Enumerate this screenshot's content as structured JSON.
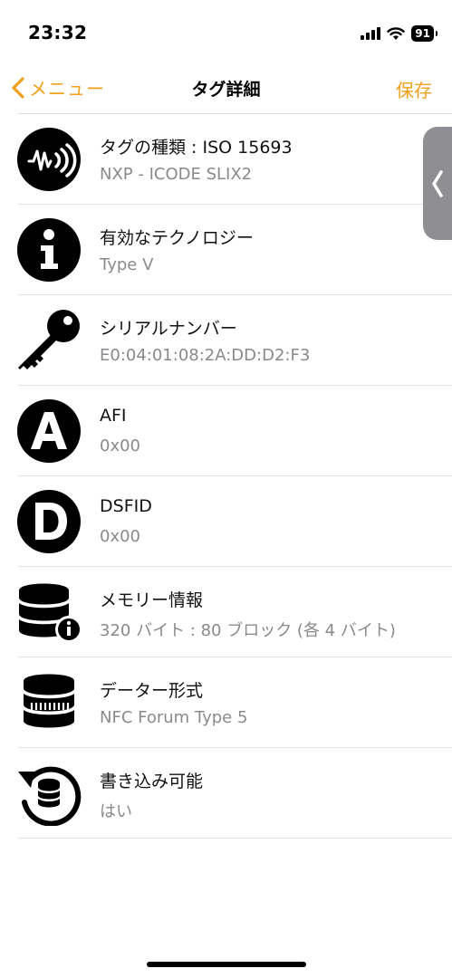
{
  "status_bar": {
    "time": "23:32",
    "battery": "91"
  },
  "nav": {
    "back_label": "メニュー",
    "title": "タグ詳細",
    "save_label": "保存"
  },
  "rows": [
    {
      "icon": "nfc-wave-icon",
      "title": "タグの種類 : ISO 15693",
      "value": "NXP - ICODE SLIX2"
    },
    {
      "icon": "info-icon",
      "title": "有効なテクノロジー",
      "value": "Type V"
    },
    {
      "icon": "key-icon",
      "title": "シリアルナンバー",
      "value": "E0:04:01:08:2A:DD:D2:F3"
    },
    {
      "icon": "letter-a-icon",
      "title": "AFI",
      "value": "0x00"
    },
    {
      "icon": "letter-d-icon",
      "title": "DSFID",
      "value": "0x00"
    },
    {
      "icon": "database-info-icon",
      "title": "メモリー情報",
      "value": "320 バイト : 80 ブロック (各 4 バイト)"
    },
    {
      "icon": "database-format-icon",
      "title": "データー形式",
      "value": "NFC Forum Type 5"
    },
    {
      "icon": "database-write-icon",
      "title": "書き込み可能",
      "value": "はい"
    }
  ],
  "colors": {
    "accent": "#f0a01d",
    "subtitle": "#8a8a8e",
    "handle": "#8e8e93"
  }
}
